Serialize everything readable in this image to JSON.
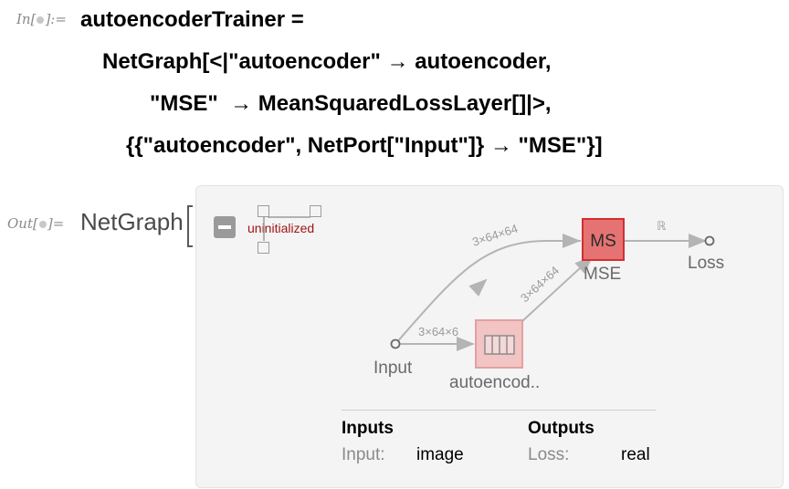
{
  "cells": {
    "in_label": "In[",
    "in_label_end": "]:=",
    "out_label": "Out[",
    "out_label_end": "]="
  },
  "input_code": {
    "line1": "autoencoderTrainer =",
    "line2": "NetGraph[<|\"autoencoder\" → autoencoder,",
    "line3": "\"MSE\"  → MeanSquaredLossLayer[]|>,",
    "line4": "{{\"autoencoder\", NetPort[\"Input\"]} → \"MSE\"}]"
  },
  "output": {
    "head": "NetGraph",
    "status": "uninitialized",
    "graph": {
      "nodes": {
        "input": "Input",
        "autoencoder_box_text": "",
        "autoencoder_label": "autoencod..",
        "mse_box": "MS",
        "mse_label": "MSE",
        "loss": "Loss"
      },
      "edges": {
        "input_to_ae": "3×64×6",
        "input_to_mse": "3×64×64",
        "ae_to_mse": "3×64×64",
        "mse_to_loss": "ℝ"
      }
    },
    "info": {
      "inputs_header": "Inputs",
      "outputs_header": "Outputs",
      "input_key": "Input:",
      "input_value": "image",
      "output_key": "Loss:",
      "output_value": "real"
    }
  },
  "colors": {
    "mse_fill": "#e57373",
    "mse_border": "#d32f2f",
    "ae_fill": "#f2c4c4",
    "ae_border": "#e3a0a0",
    "status_text": "#a01414",
    "edge": "#b4b4b4"
  }
}
